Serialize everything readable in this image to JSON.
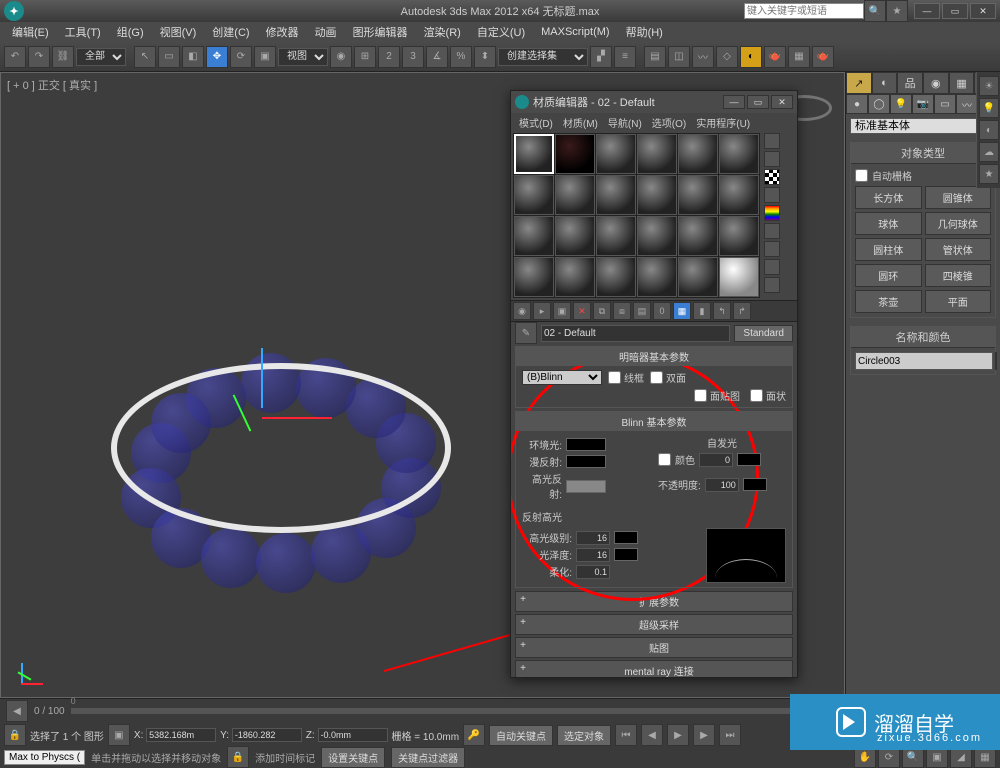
{
  "titlebar": {
    "title": "Autodesk 3ds Max  2012 x64  无标题.max",
    "search_placeholder": "键入关键字或短语"
  },
  "menubar": [
    "编辑(E)",
    "工具(T)",
    "组(G)",
    "视图(V)",
    "创建(C)",
    "修改器",
    "动画",
    "图形编辑器",
    "渲染(R)",
    "自定义(U)",
    "MAXScript(M)",
    "帮助(H)"
  ],
  "toolbar": {
    "scope": "全部",
    "view": "视图",
    "selset": "创建选择集"
  },
  "viewport": {
    "label": "[ + 0 ] 正交 [ 真实 ]"
  },
  "cmdpanel": {
    "dropdown": "标准基本体",
    "rollout_objtype": {
      "title": "对象类型",
      "autogrid": "自动栅格",
      "buttons": [
        "长方体",
        "圆锥体",
        "球体",
        "几何球体",
        "圆柱体",
        "管状体",
        "圆环",
        "四棱锥",
        "茶壶",
        "平面"
      ]
    },
    "rollout_name": {
      "title": "名称和颜色",
      "value": "Circle003"
    }
  },
  "mateditor": {
    "title": "材质编辑器 - 02 - Default",
    "menu": [
      "模式(D)",
      "材质(M)",
      "导航(N)",
      "选项(O)",
      "实用程序(U)"
    ],
    "name_field": "02 - Default",
    "std_button": "Standard",
    "roll_shader": {
      "title": "明暗器基本参数",
      "shader": "(B)Blinn",
      "wire": "线框",
      "twosided": "双面",
      "facemap": "面贴图",
      "faceted": "面状"
    },
    "roll_blinn": {
      "title": "Blinn 基本参数",
      "selfillum_title": "自发光",
      "selfillum_color": "颜色",
      "selfillum_val": "0",
      "ambient": "环境光:",
      "diffuse": "漫反射:",
      "specular": "高光反射:",
      "opacity_lbl": "不透明度:",
      "opacity_val": "100",
      "spec_title": "反射高光",
      "spec_level": "高光级别:",
      "spec_level_val": "16",
      "gloss": "光泽度:",
      "gloss_val": "16",
      "soften": "柔化:",
      "soften_val": "0.1"
    },
    "bars": [
      "扩展参数",
      "超级采样",
      "贴图",
      "mental ray 连接"
    ]
  },
  "bottom": {
    "range": "0 / 100",
    "selection": "选择了 1 个 图形",
    "x": "5382.168m",
    "y": "-1860.282",
    "z": "-0.0mm",
    "grid": "栅格 = 10.0mm",
    "autokey": "自动关键点",
    "selfilter": "选定对象",
    "maxphys": "Max to Physcs (",
    "hint": "单击并拖动以选择并移动对象",
    "addtime": "添加时间标记",
    "setkey": "设置关键点",
    "keyfilter": "关键点过滤器"
  },
  "watermark": {
    "brand": "溜溜自学",
    "url": "zixue.3d66.com"
  }
}
